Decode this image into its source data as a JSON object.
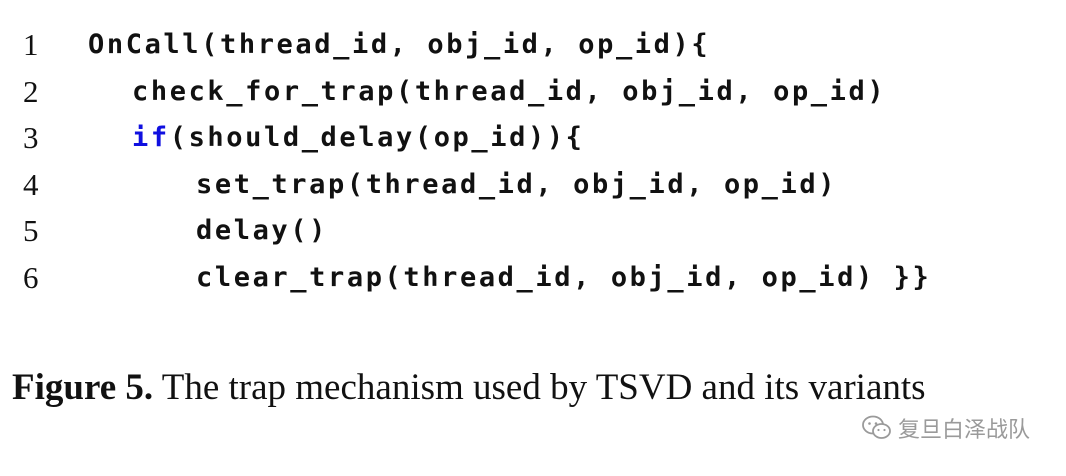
{
  "code": {
    "lines": [
      {
        "no": "1",
        "text": "OnCall(thread_id, obj_id, op_id){"
      },
      {
        "no": "2",
        "text": "check_for_trap(thread_id, obj_id, op_id)"
      },
      {
        "no": "3",
        "keyword": "if",
        "text": "(should_delay(op_id)){"
      },
      {
        "no": "4",
        "text": "set_trap(thread_id, obj_id, op_id)"
      },
      {
        "no": "5",
        "text": "delay()"
      },
      {
        "no": "6",
        "text": "clear_trap(thread_id, obj_id, op_id) }}"
      }
    ],
    "keyword_color": "#1010e0"
  },
  "caption": {
    "label": "Figure 5.",
    "text": "The trap mechanism used by TSVD and its variants"
  },
  "watermark": {
    "icon": "wechat-icon",
    "text": "复旦白泽战队"
  }
}
